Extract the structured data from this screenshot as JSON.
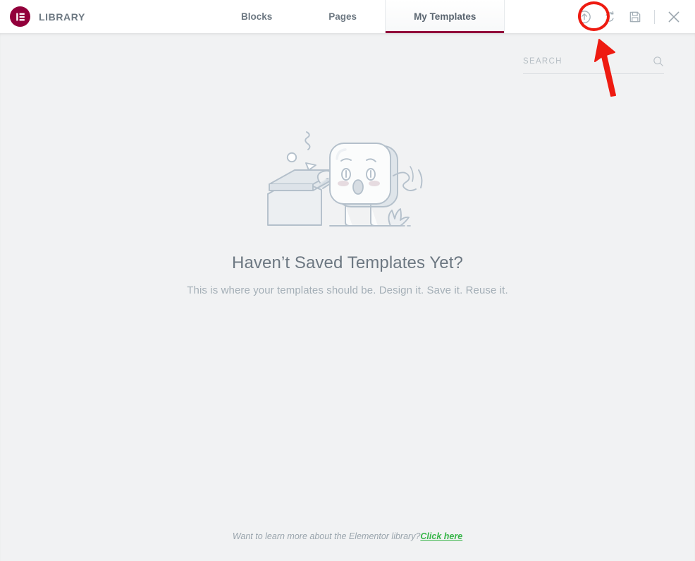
{
  "window": {
    "title": "LIBRARY",
    "logo_icon": "elementor-logo-icon"
  },
  "tabs": [
    {
      "id": "blocks",
      "label": "Blocks",
      "active": false
    },
    {
      "id": "pages",
      "label": "Pages",
      "active": false
    },
    {
      "id": "my-templates",
      "label": "My Templates",
      "active": true
    }
  ],
  "header_actions": [
    {
      "id": "upload",
      "icon": "upload-circle-icon",
      "title": "Import Template"
    },
    {
      "id": "sync",
      "icon": "sync-icon",
      "title": "Sync Library"
    },
    {
      "id": "save",
      "icon": "save-floppy-icon",
      "title": "Save"
    },
    {
      "id": "close",
      "icon": "close-icon",
      "title": "Close"
    }
  ],
  "search": {
    "placeholder": "SEARCH",
    "value": "",
    "icon": "search-icon"
  },
  "empty_state": {
    "illustration": "surprised-box-character-illustration",
    "title": "Haven’t Saved Templates Yet?",
    "subtitle": "This is where your templates should be. Design it. Save it. Reuse it."
  },
  "footer": {
    "text": "Want to learn more about the Elementor library?",
    "link_label": "Click here"
  },
  "annotation": {
    "type": "red-circle-and-arrow",
    "target": "upload-circle-icon",
    "color": "#ee1b11"
  },
  "colors": {
    "brand": "#92003b",
    "link_green": "#39b54a",
    "text_gray": "#6d7882",
    "muted_gray": "#a4afb7",
    "body_bg": "#f1f2f3",
    "header_bg": "#ffffff"
  }
}
